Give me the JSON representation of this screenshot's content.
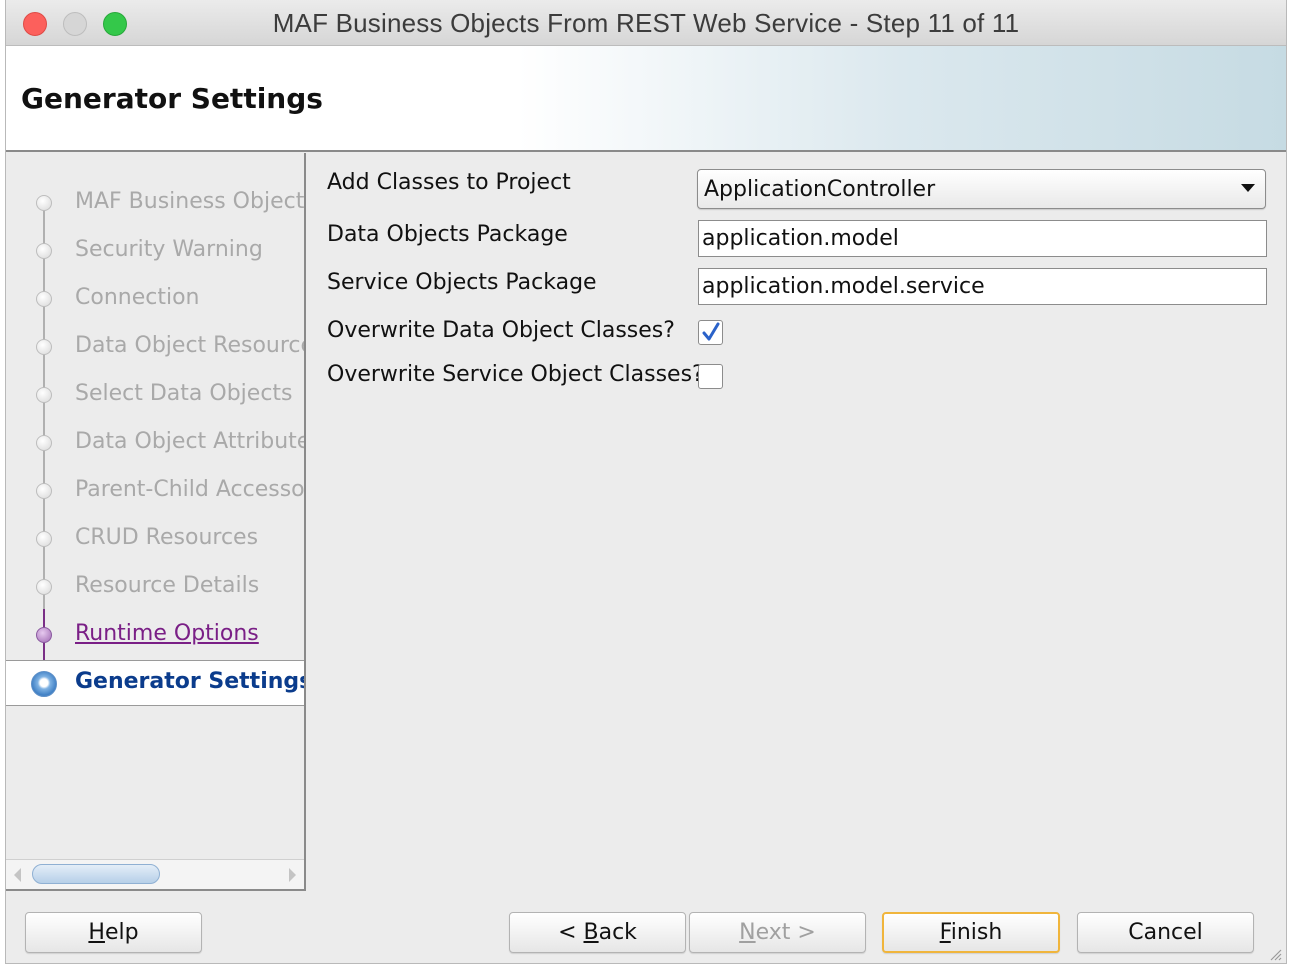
{
  "window": {
    "title": "MAF Business Objects From REST Web Service - Step 11 of 11"
  },
  "header": {
    "title": "Generator Settings"
  },
  "nav": {
    "items": [
      {
        "label": "MAF Business Objects",
        "state": "pending"
      },
      {
        "label": "Security Warning",
        "state": "pending"
      },
      {
        "label": "Connection",
        "state": "pending"
      },
      {
        "label": "Data Object Resource",
        "state": "pending"
      },
      {
        "label": "Select Data Objects",
        "state": "pending"
      },
      {
        "label": "Data Object Attributes",
        "state": "pending"
      },
      {
        "label": "Parent-Child Accessor",
        "state": "pending"
      },
      {
        "label": "CRUD Resources",
        "state": "pending"
      },
      {
        "label": "Resource Details",
        "state": "pending"
      },
      {
        "label": "Runtime Options",
        "state": "visited"
      },
      {
        "label": "Generator Settings",
        "state": "current"
      }
    ]
  },
  "form": {
    "add_classes_label": "Add Classes to Project",
    "add_classes_value": "ApplicationController",
    "data_package_label": "Data Objects Package",
    "data_package_value": "application.model",
    "service_package_label": "Service Objects Package",
    "service_package_value": "application.model.service",
    "overwrite_data_label": "Overwrite Data Object Classes?",
    "overwrite_data_checked": true,
    "overwrite_service_label": "Overwrite Service Object Classes?",
    "overwrite_service_checked": false
  },
  "buttons": {
    "help": {
      "mnemonic": "H",
      "rest": "elp"
    },
    "back": {
      "prefix": "< ",
      "mnemonic": "B",
      "rest": "ack"
    },
    "next": {
      "mnemonic": "N",
      "rest": "ext >"
    },
    "finish": {
      "mnemonic": "F",
      "rest": "inish"
    },
    "cancel": "Cancel"
  },
  "colors": {
    "current_step": "#0b3c8c",
    "visited_step": "#7a1f86",
    "default_button_border": "#f0b53c"
  }
}
